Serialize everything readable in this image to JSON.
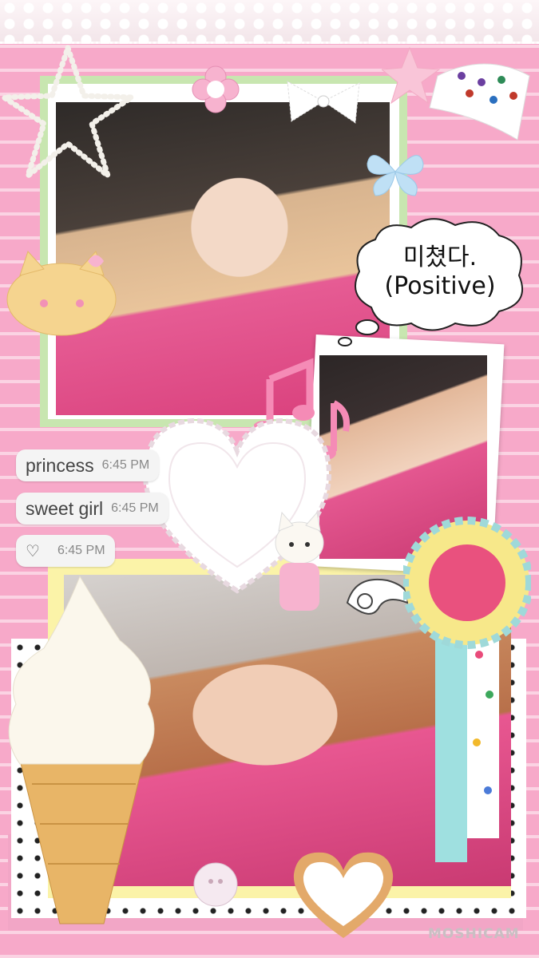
{
  "speech_bubble": {
    "line1": "미쳤다.",
    "line2": "(Positive)"
  },
  "chat": [
    {
      "message": "princess",
      "time": "6:45 PM"
    },
    {
      "message": "sweet girl",
      "time": "6:45 PM"
    },
    {
      "icon": "heart-outline-icon",
      "time": "6:45 PM"
    }
  ],
  "watermark": "MOSHICAM",
  "colors": {
    "background_pink": "#f7a9c9",
    "stripe_light": "#fbd3e3",
    "frame_green": "#c8e6b0",
    "frame_yellow": "#fbf3a8",
    "polka_dot": "#222222"
  }
}
